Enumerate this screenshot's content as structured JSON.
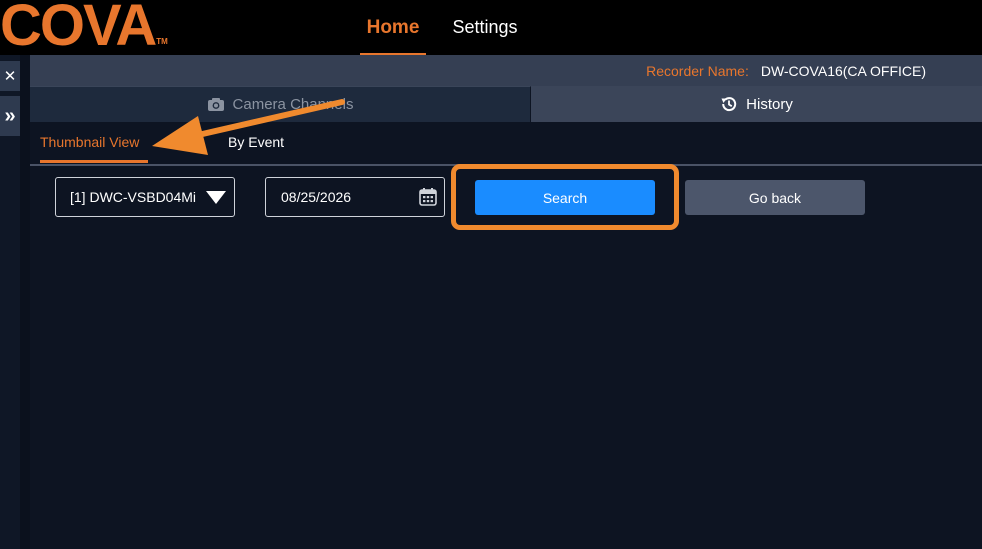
{
  "header": {
    "logo_text": "COVA",
    "logo_tm": "TM",
    "nav": [
      {
        "label": "Home"
      },
      {
        "label": "Settings"
      }
    ]
  },
  "sidebar": {
    "close_glyph": "✕",
    "expand_glyph": "»"
  },
  "recorder": {
    "label": "Recorder Name:",
    "value": "DW-COVA16(CA OFFICE)"
  },
  "tabs": [
    {
      "label": "Camera Channels",
      "icon": "camera-icon"
    },
    {
      "label": "History",
      "icon": "history-icon"
    }
  ],
  "subtabs": [
    {
      "label": "Thumbnail View"
    },
    {
      "label": "By Event"
    }
  ],
  "filters": {
    "camera_select": "[1] DWC-VSBD04Mi",
    "date_value": "08/25/2026"
  },
  "buttons": {
    "search": "Search",
    "go_back": "Go back"
  },
  "colors": {
    "accent": "#e8762d",
    "highlight": "#f08a2e",
    "search_blue": "#1a8cff",
    "background": "#0d1422"
  }
}
